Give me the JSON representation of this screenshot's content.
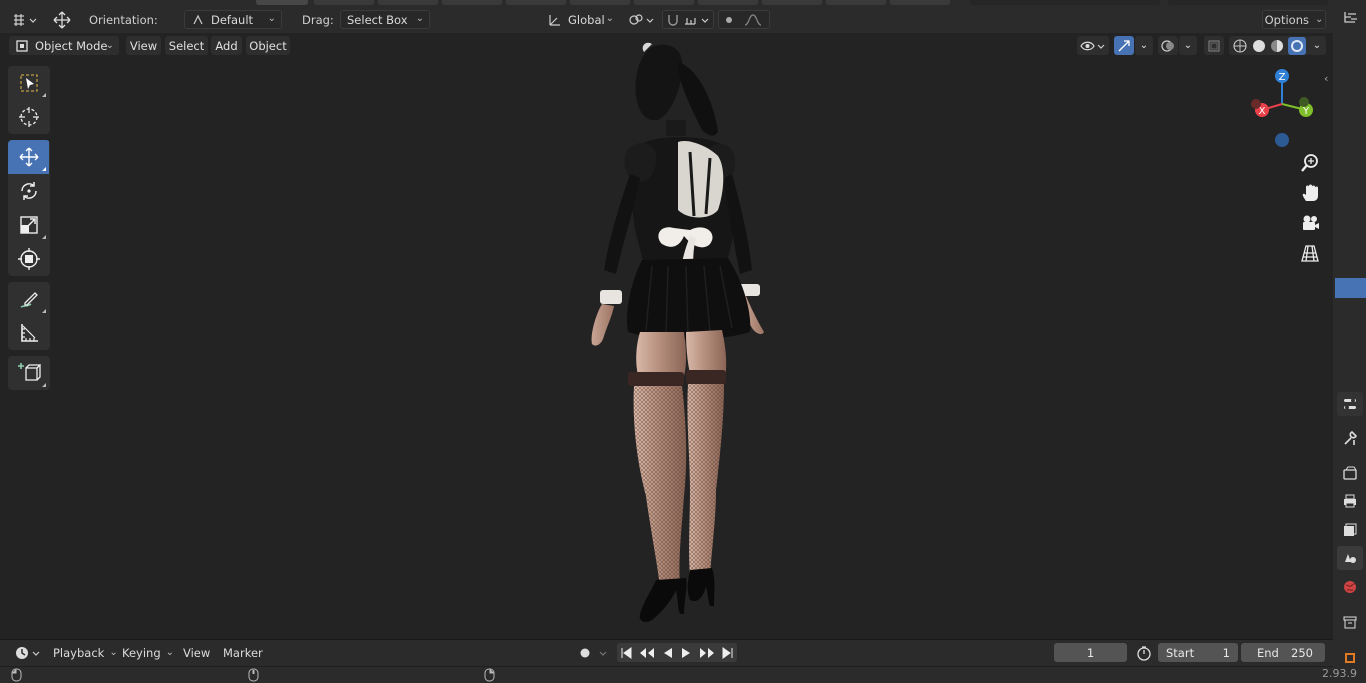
{
  "tool_header": {
    "orientation_label": "Orientation:",
    "orientation_value": "Default",
    "drag_label": "Drag:",
    "drag_value": "Select Box",
    "transform_orientation": "Global",
    "options_label": "Options"
  },
  "viewport_header": {
    "mode": "Object Mode",
    "menus": [
      "View",
      "Select",
      "Add",
      "Object"
    ]
  },
  "toolbar": {
    "tools": [
      {
        "icon": "select-box-icon",
        "active": false
      },
      {
        "icon": "cursor-icon",
        "active": false
      },
      {
        "icon": "move-icon",
        "active": true
      },
      {
        "icon": "rotate-icon",
        "active": false
      },
      {
        "icon": "scale-icon",
        "active": false
      },
      {
        "icon": "transform-icon",
        "active": false
      },
      {
        "icon": "annotate-icon",
        "active": false
      },
      {
        "icon": "measure-icon",
        "active": false
      },
      {
        "icon": "add-cube-icon",
        "active": false
      }
    ]
  },
  "gizmo": {
    "x": "X",
    "y": "Y",
    "z": "Z"
  },
  "timeline": {
    "menus": [
      "Playback",
      "Keying",
      "View",
      "Marker"
    ],
    "current_frame": "1",
    "start_label": "Start",
    "start_value": "1",
    "end_label": "End",
    "end_value": "250"
  },
  "status": {
    "version": "2.93.9"
  },
  "colors": {
    "accent": "#4772b3",
    "x_axis": "#e8414a",
    "y_axis": "#7fbf2a",
    "z_axis": "#2f7fd6"
  }
}
